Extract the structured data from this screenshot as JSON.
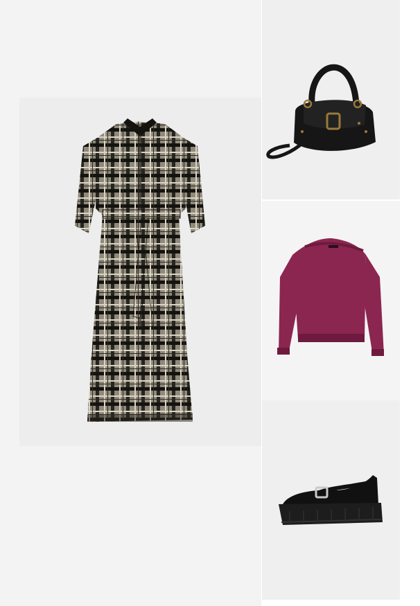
{
  "board": {
    "background": "#ffffff",
    "panel_background": "#f3f3f3"
  },
  "items": [
    {
      "id": "dress",
      "kind": "plaid shirt dress",
      "colors": {
        "bg": "#ededed",
        "base": "#8f8a7b",
        "dark": "#15130f",
        "light": "#d9d4c4"
      }
    },
    {
      "id": "bag",
      "kind": "black leather shoulder bag",
      "colors": {
        "bg": "#efefef",
        "leather": "#161616",
        "hardware": "#9a7a3a"
      }
    },
    {
      "id": "sweater",
      "kind": "burgundy off-shoulder sweatshirt",
      "colors": {
        "bg": "#f4f4f4",
        "fabric": "#8b2650",
        "shade": "#6e1a3e"
      }
    },
    {
      "id": "shoe",
      "kind": "black chunky mary jane",
      "colors": {
        "bg": "#efefef",
        "leather": "#111111",
        "sole": "#1d1d1d",
        "buckle": "#c9c9c9"
      }
    }
  ]
}
